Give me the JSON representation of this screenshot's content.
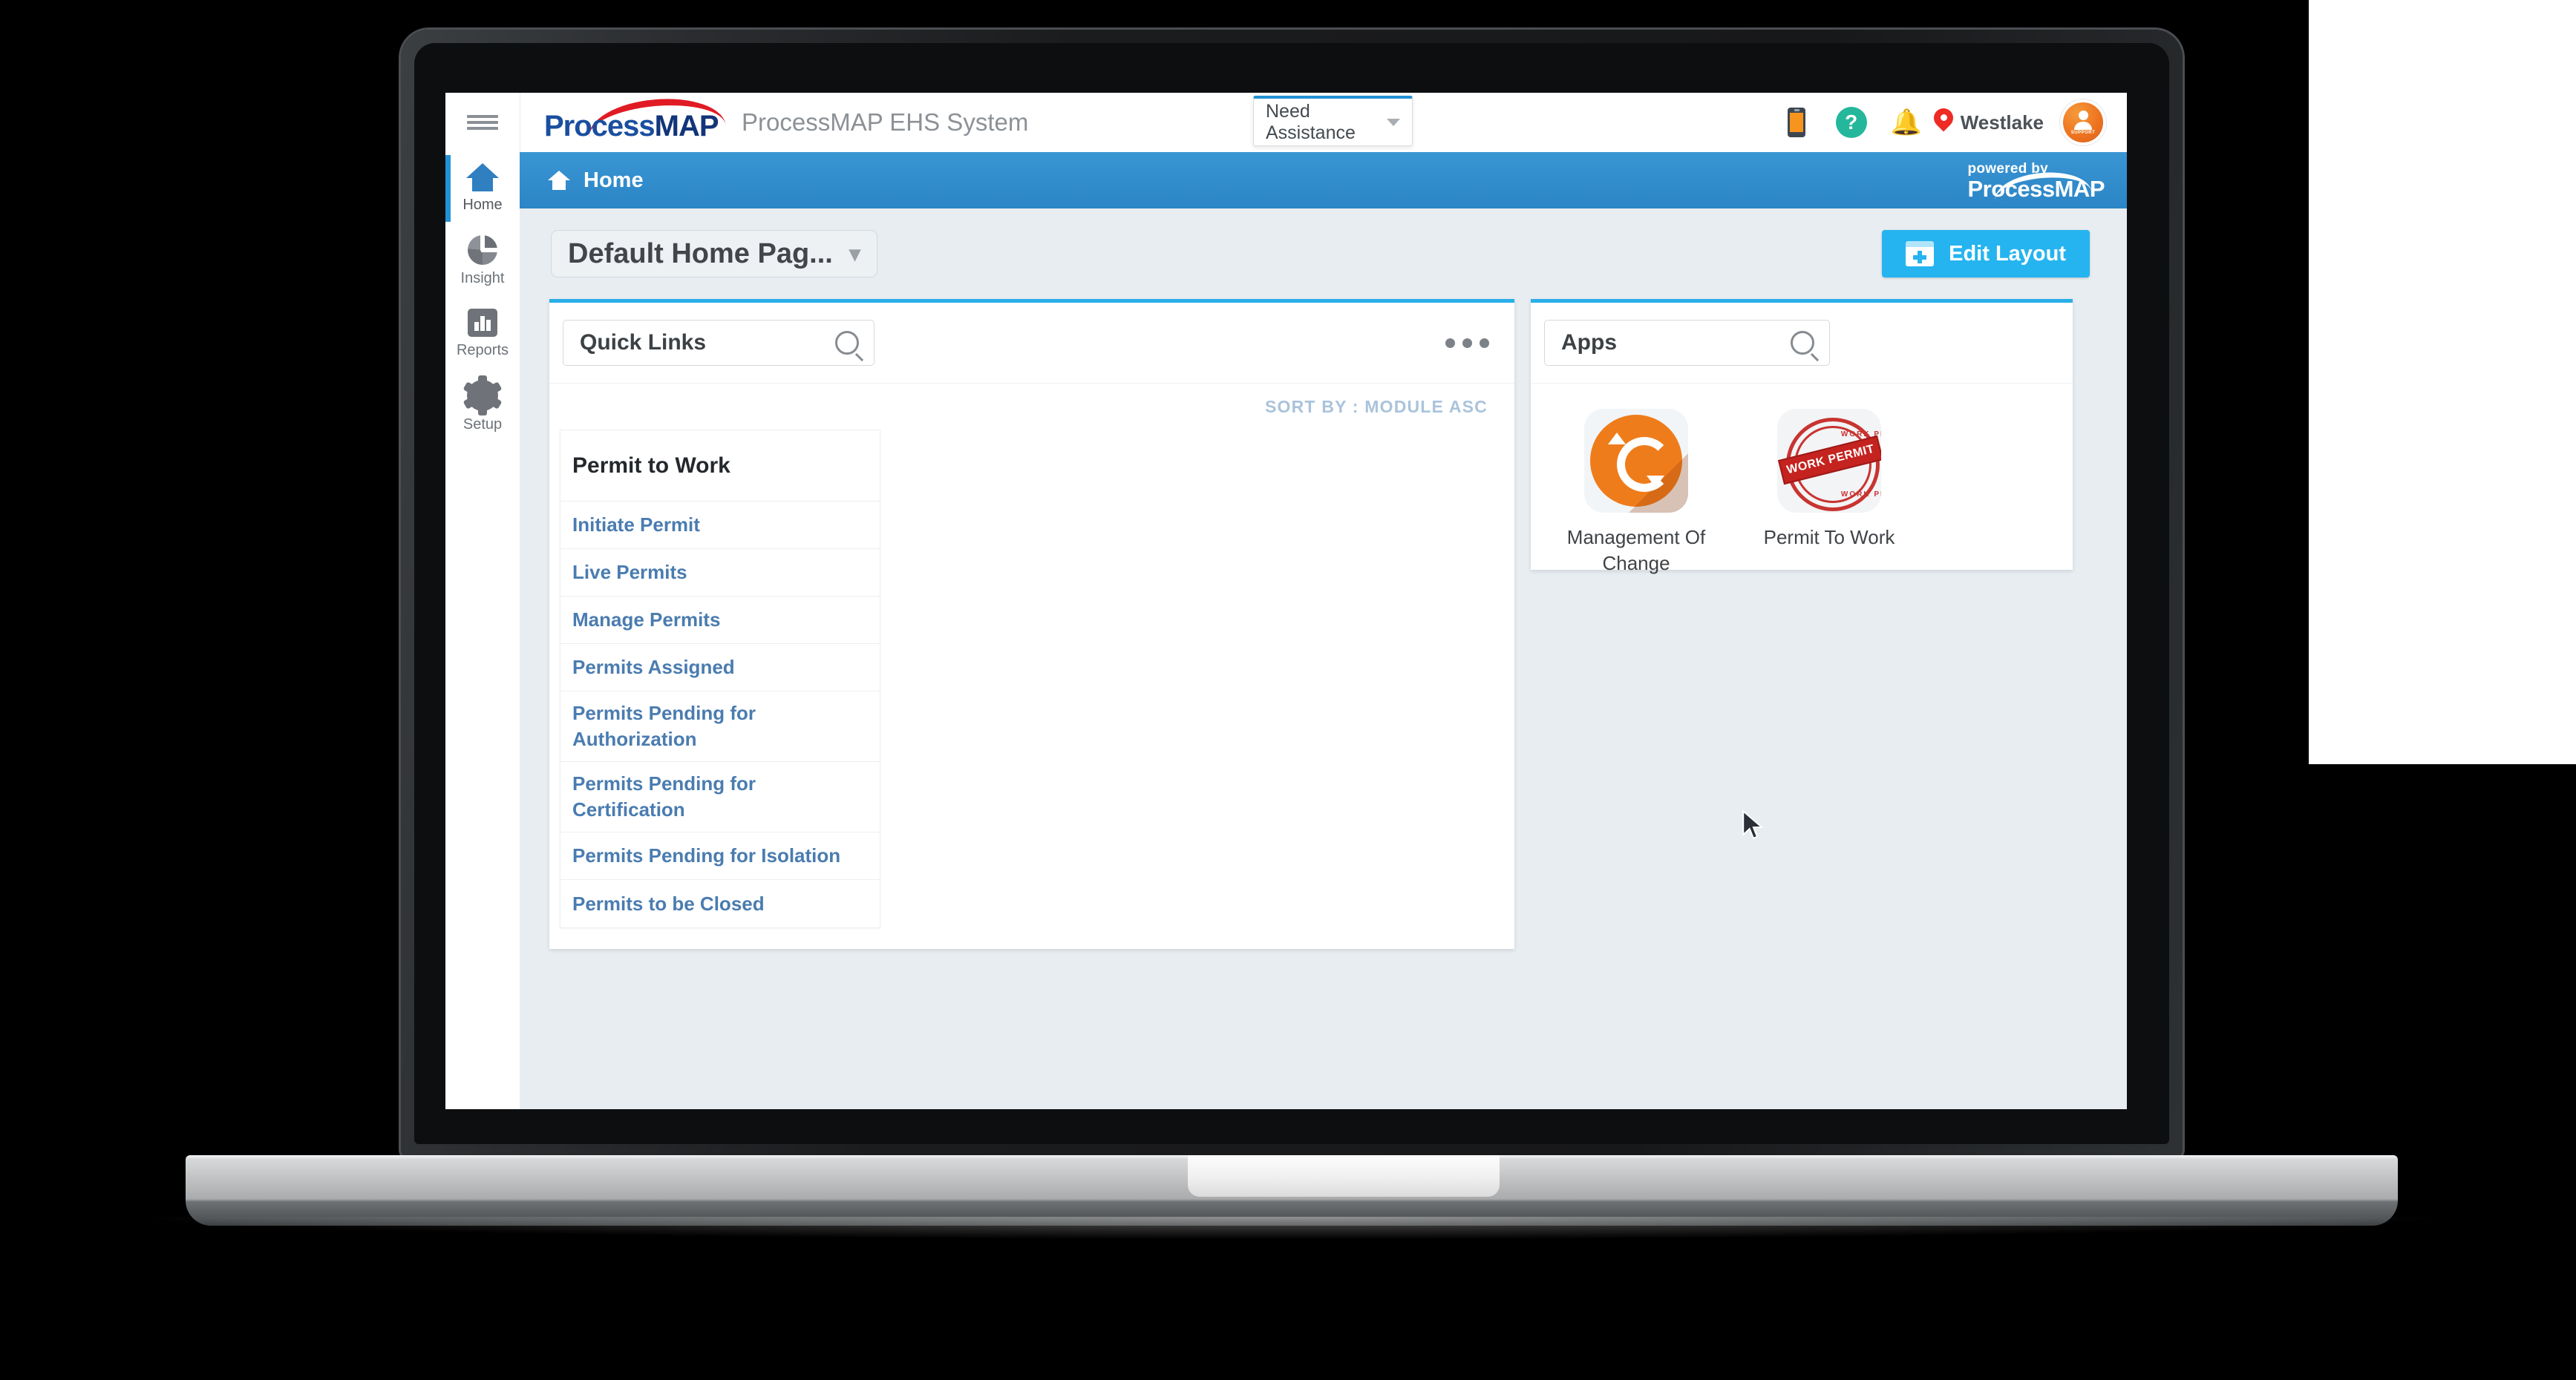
{
  "app": {
    "brand_primary": "ProcessMAP",
    "brand_part1": "Process",
    "brand_part2": "MAP",
    "system_title": "ProcessMAP EHS System",
    "accent_blue": "#2392d4",
    "accent_cyan": "#25b4f0",
    "link_blue": "#4a7cb0"
  },
  "topbar": {
    "menu_icon": "hamburger-icon",
    "assistance": {
      "label": "Need Assistance",
      "caret": "chevron-down-icon"
    },
    "icons": [
      {
        "name": "mobile-app-icon"
      },
      {
        "name": "help-icon",
        "glyph": "?"
      },
      {
        "name": "notifications-bell-icon"
      },
      {
        "name": "location-pin-icon"
      }
    ],
    "location": "Westlake",
    "support_badge": {
      "label": "SUPPORT"
    }
  },
  "sidebar": {
    "items": [
      {
        "label": "Home",
        "icon": "home-icon",
        "active": true
      },
      {
        "label": "Insight",
        "icon": "pie-chart-icon",
        "active": false
      },
      {
        "label": "Reports",
        "icon": "bar-chart-icon",
        "active": false
      },
      {
        "label": "Setup",
        "icon": "gear-icon",
        "active": false
      }
    ]
  },
  "breadcrumb": {
    "icon": "home-icon",
    "label": "Home",
    "powered_by": "powered by",
    "powered_brand_1": "Process",
    "powered_brand_2": "MAP"
  },
  "pagebar": {
    "page_selector": "Default Home Pag...",
    "page_selector_caret": "chevron-down-icon",
    "edit_layout": "Edit Layout",
    "edit_layout_icon": "layout-add-icon"
  },
  "quick_links_panel": {
    "search_value": "Quick Links",
    "search_icon": "search-icon",
    "more_icon": "more-options-icon",
    "sort_label": "SORT BY : MODULE ASC",
    "module": {
      "title": "Permit to Work",
      "links": [
        "Initiate Permit",
        "Live Permits",
        "Manage Permits",
        "Permits Assigned",
        "Permits Pending for Authorization",
        "Permits Pending for Certification",
        "Permits Pending for Isolation",
        "Permits to be Closed"
      ]
    }
  },
  "apps_panel": {
    "search_value": "Apps",
    "search_icon": "search-icon",
    "apps": [
      {
        "name": "Management Of Change",
        "icon": "refresh-cycle-icon"
      },
      {
        "name": "Permit To Work",
        "icon": "work-permit-stamp-icon",
        "stamp_top": "WORK PERMIT",
        "stamp_band": "WORK PERMIT",
        "stamp_bottom": "WORK PERMIT"
      }
    ]
  }
}
